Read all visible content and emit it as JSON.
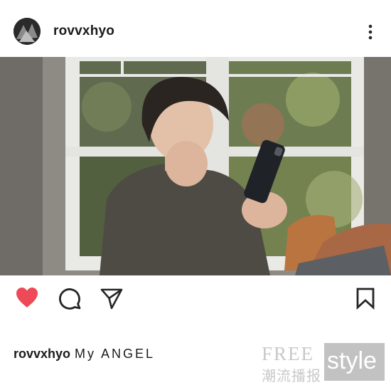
{
  "post": {
    "username": "rovvxhyo",
    "caption_username": "rovvxhyo",
    "caption_text": "My ANGEL"
  },
  "watermark": {
    "free": "FREE",
    "cn": "潮流播报",
    "style": "style"
  },
  "icons": {
    "more": "more-vertical-icon",
    "like": "heart-icon",
    "comment": "comment-icon",
    "share": "paper-plane-icon",
    "save": "bookmark-icon"
  },
  "colors": {
    "like_active": "#ed4956",
    "text": "#262626",
    "watermark": "#c2c2c2"
  }
}
